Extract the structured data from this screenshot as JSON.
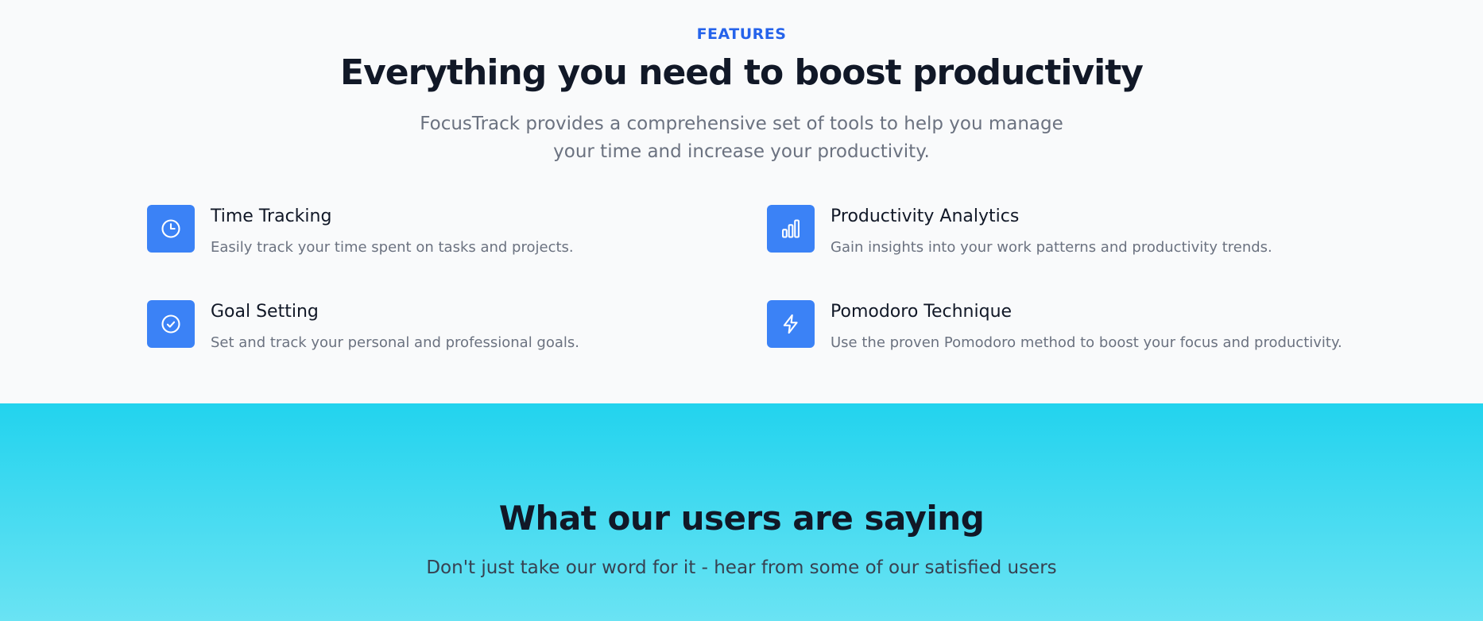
{
  "features_section": {
    "eyebrow": "FEATURES",
    "headline": "Everything you need to boost productivity",
    "lead": "FocusTrack provides a comprehensive set of tools to help you manage your time and increase your productivity.",
    "items": [
      {
        "title": "Time Tracking",
        "description": "Easily track your time spent on tasks and projects.",
        "icon": "clock-icon"
      },
      {
        "title": "Productivity Analytics",
        "description": "Gain insights into your work patterns and productivity trends.",
        "icon": "bar-chart-icon"
      },
      {
        "title": "Goal Setting",
        "description": "Set and track your personal and professional goals.",
        "icon": "check-circle-icon"
      },
      {
        "title": "Pomodoro Technique",
        "description": "Use the proven Pomodoro method to boost your focus and productivity.",
        "icon": "lightning-icon"
      }
    ]
  },
  "testimonials_section": {
    "heading": "What our users are saying",
    "subheading": "Don't just take our word for it - hear from some of our satisfied users"
  },
  "colors": {
    "accent": "#2563eb",
    "icon_bg": "#3b82f6",
    "testimonial_gradient_top": "#22d3ee",
    "testimonial_gradient_bottom": "#6ae3f3",
    "heading_text": "#111827",
    "muted_text": "#6b7280"
  }
}
